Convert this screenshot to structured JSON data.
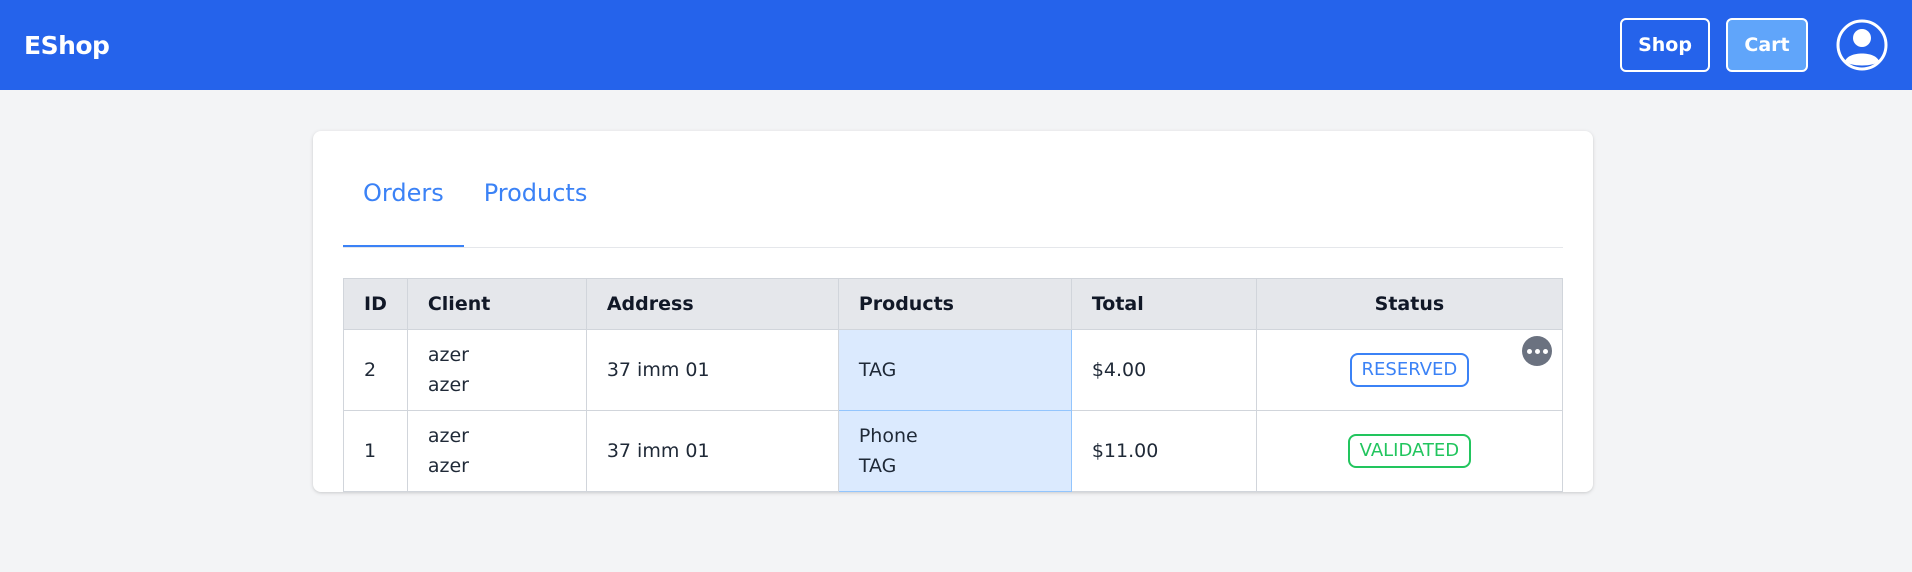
{
  "navbar": {
    "brand": "EShop",
    "shop_label": "Shop",
    "cart_label": "Cart",
    "avatar_icon": "user-circle-icon"
  },
  "tabs": [
    {
      "label": "Orders",
      "active": true
    },
    {
      "label": "Products",
      "active": false
    }
  ],
  "table": {
    "headers": [
      "ID",
      "Client",
      "Address",
      "Products",
      "Total",
      "Status"
    ],
    "rows": [
      {
        "id": "2",
        "client": [
          "azer",
          "azer"
        ],
        "address": "37 imm 01",
        "products": [
          "TAG"
        ],
        "total": "$4.00",
        "status": "RESERVED"
      },
      {
        "id": "1",
        "client": [
          "azer",
          "azer"
        ],
        "address": "37 imm 01",
        "products": [
          "Phone",
          "TAG"
        ],
        "total": "$11.00",
        "status": "VALIDATED"
      }
    ]
  },
  "colors": {
    "navbar": "#2563eb",
    "reserved": "#3b82f6",
    "validated": "#22c55e",
    "products_highlight": "#dbeafe"
  },
  "row_action_icon": "more-horizontal-icon"
}
